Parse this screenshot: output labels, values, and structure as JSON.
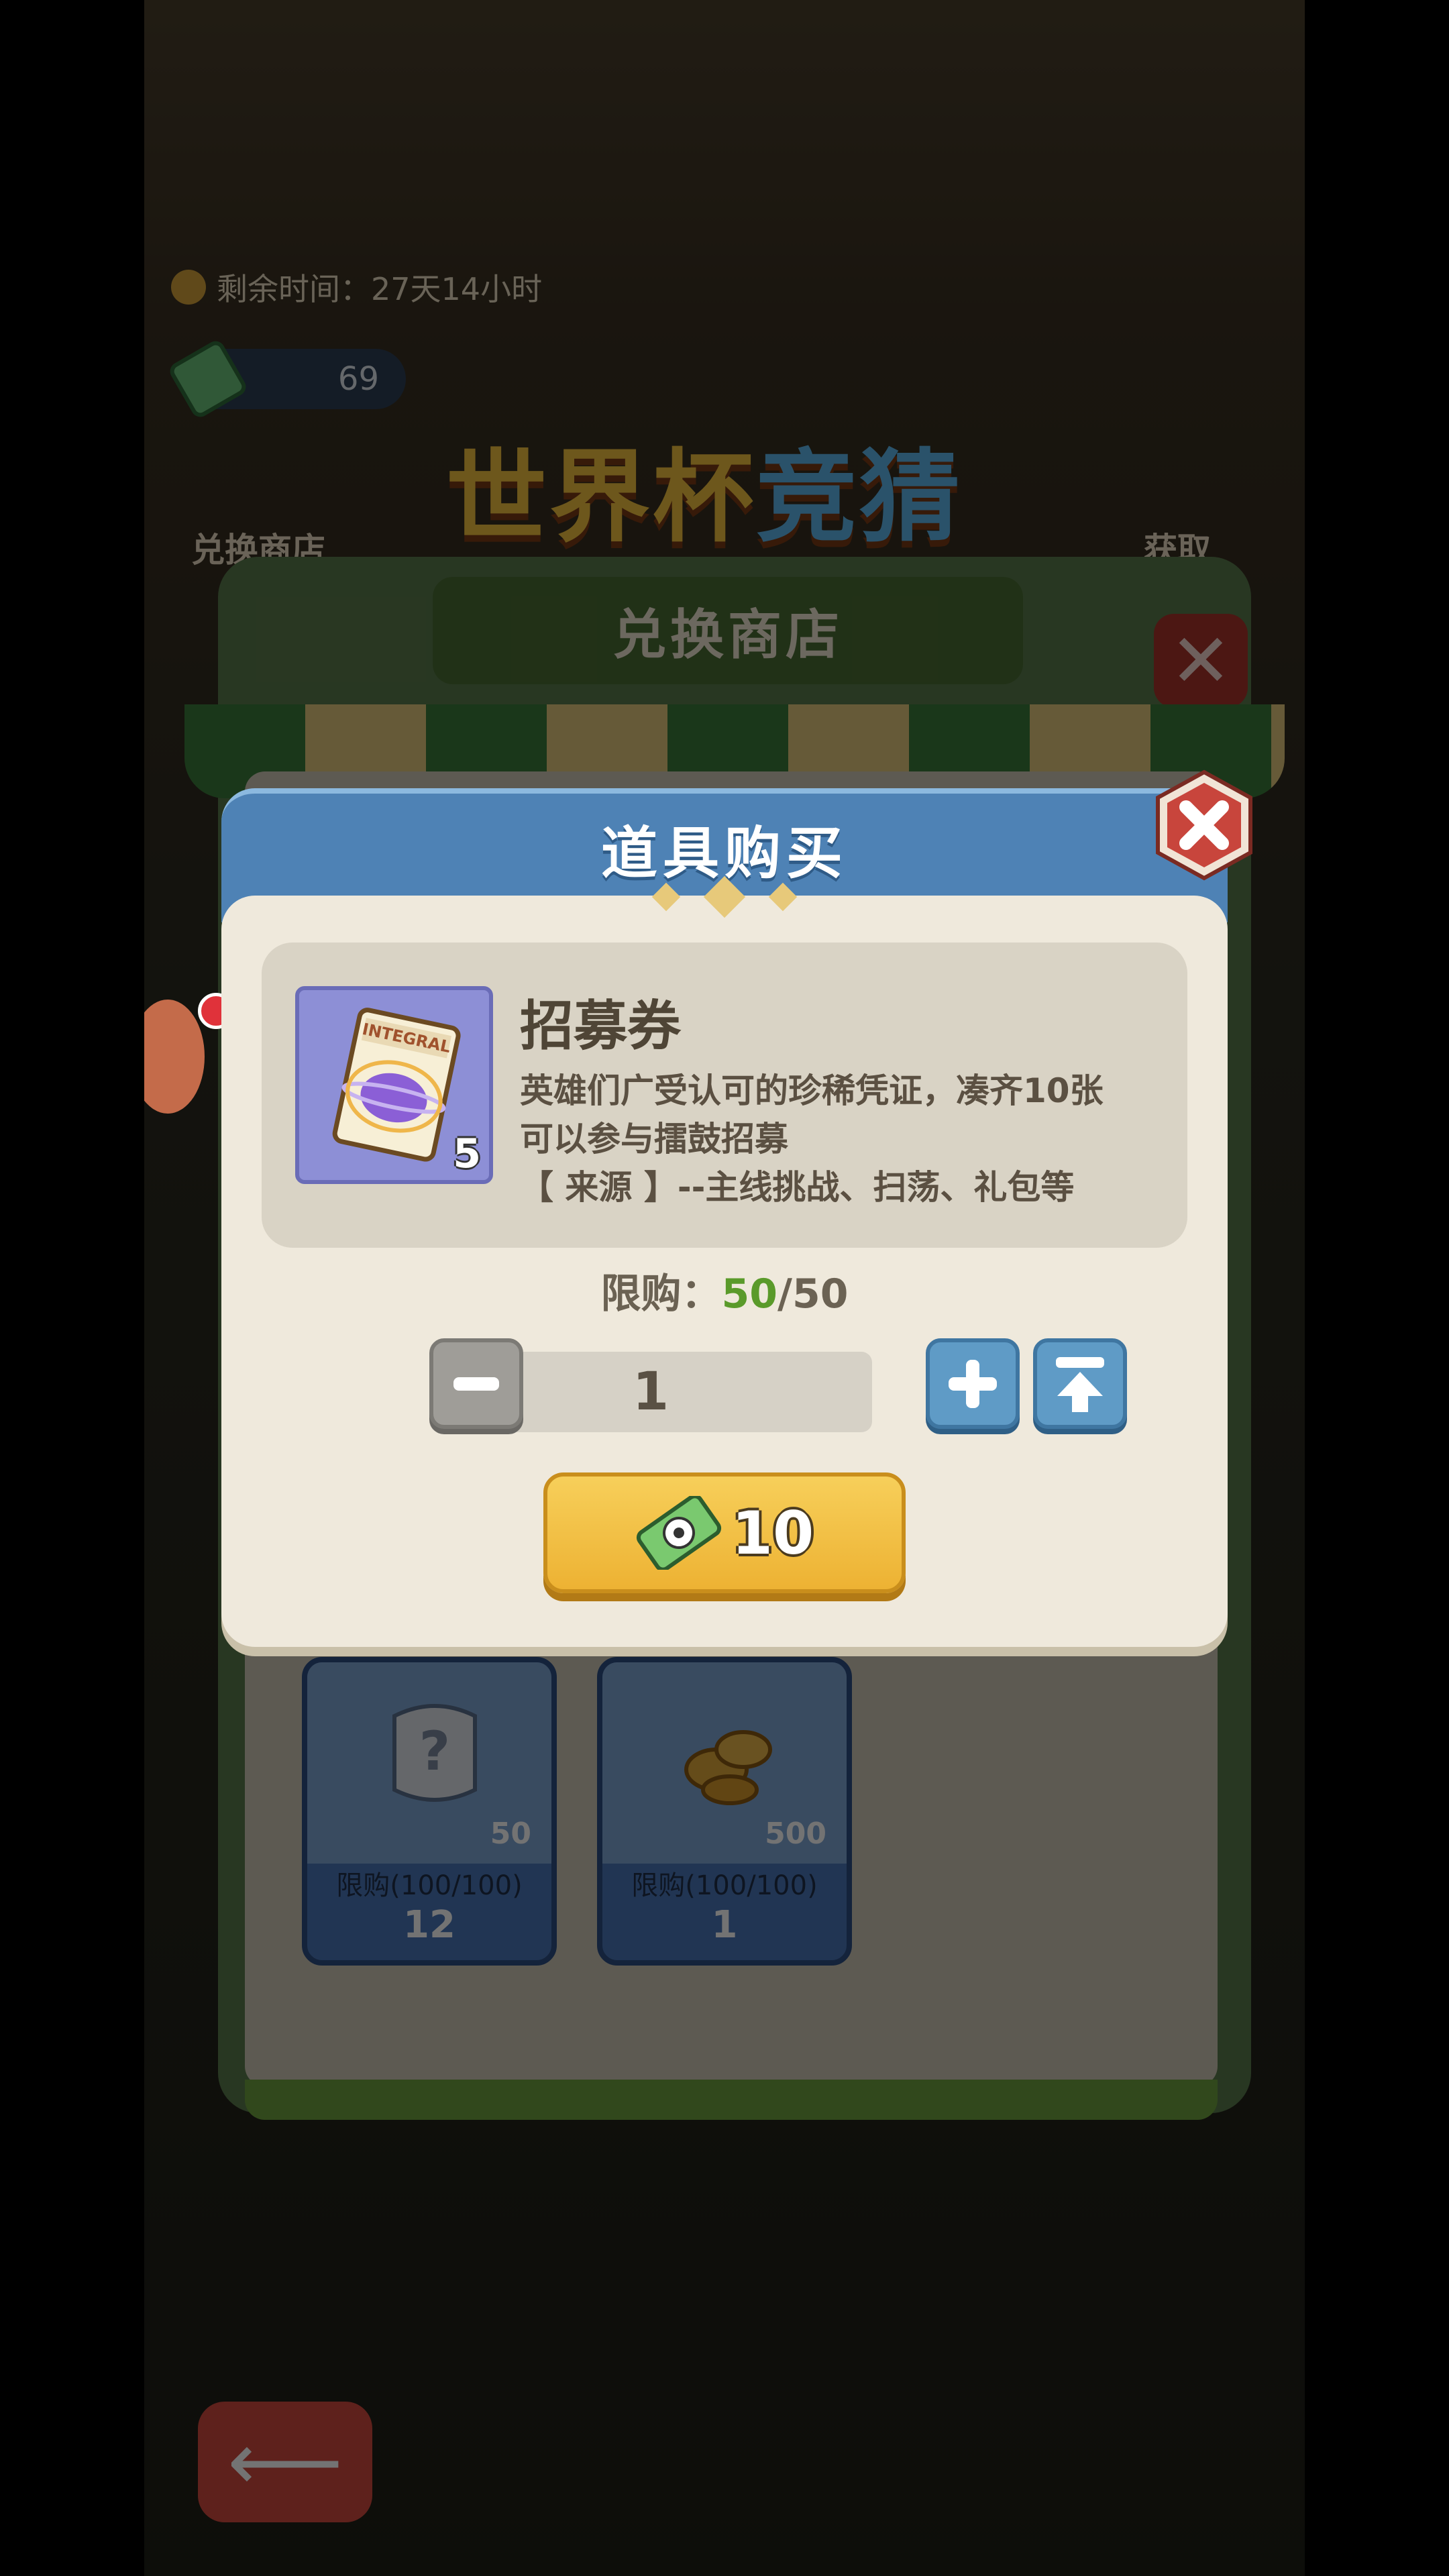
{
  "background": {
    "timer_label": "剩余时间：27天14小时",
    "currency_amount": "69",
    "event_title_main": "世界杯",
    "event_title_accent": "竞猜",
    "left_menu_label": "兑换商店",
    "right_menu_label": "获取",
    "shop_title": "兑换商店",
    "cards": [
      {
        "qty": "50",
        "limit": "限购(100/100)",
        "cost": "12"
      },
      {
        "qty": "500",
        "limit": "限购(100/100)",
        "cost": "1"
      }
    ]
  },
  "dialog": {
    "title": "道具购买",
    "item": {
      "name": "招募券",
      "count": "5",
      "icon_text": "INTEGRAL",
      "desc_line1": "英雄们广受认可的珍稀凭证，凑齐10张",
      "desc_line2": "可以参与擂鼓招募",
      "desc_line3": "【 来源 】--主线挑战、扫荡、礼包等"
    },
    "limit_label": "限购：",
    "limit_current": "50",
    "limit_sep_total": "/50",
    "quantity": "1",
    "price": "10"
  },
  "colors": {
    "header_blue": "#4e82b5",
    "body_cream": "#efe9dc",
    "buy_yellow": "#f2c04a",
    "limit_green": "#5a9a2a",
    "close_red": "#c8453c"
  }
}
